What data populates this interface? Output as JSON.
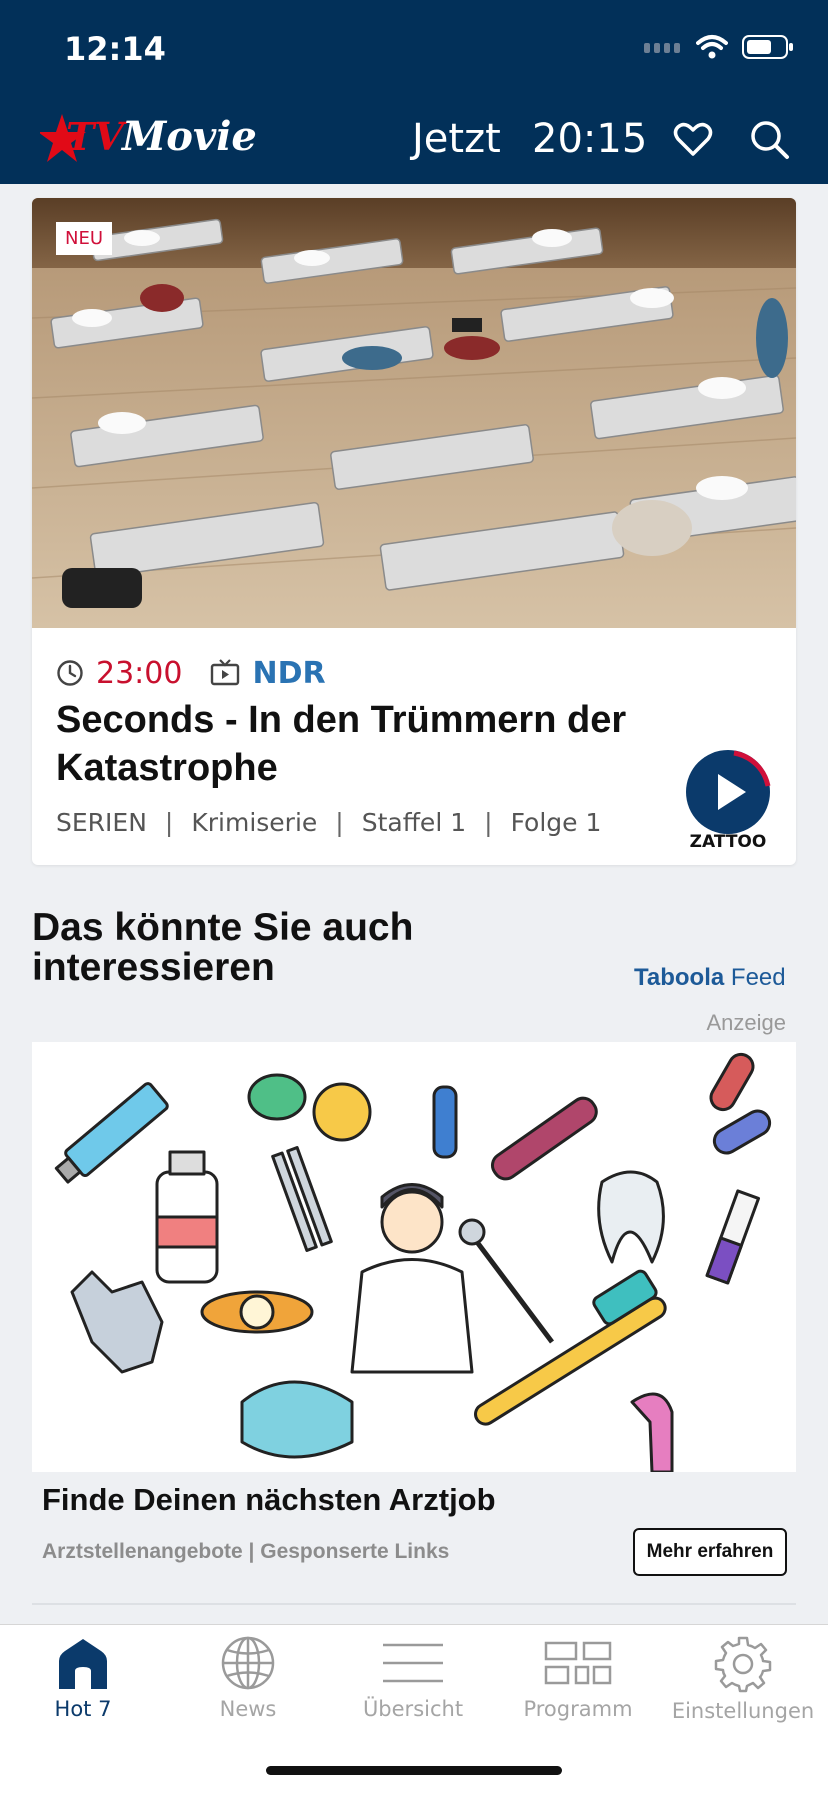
{
  "status_bar": {
    "time": "12:14"
  },
  "header": {
    "logo_text": "TV Movie",
    "nav_now": "Jetzt",
    "nav_primetime": "20:15",
    "icons": [
      "heart-icon",
      "search-icon"
    ]
  },
  "featured": {
    "badge": "NEU",
    "time": "23:00",
    "channel": "NDR",
    "title": "Seconds - In den Trümmern der Katastrophe",
    "tags": [
      "SERIEN",
      "Krimiserie",
      "Staffel 1",
      "Folge 1"
    ],
    "zattoo_label": "ZATTOO",
    "colors": {
      "time": "#c8102e",
      "channel": "#2a73b3",
      "zattoo": "#0b3a6b"
    }
  },
  "recommendations": {
    "title": "Das könnte Sie auch interessieren",
    "provider_brand": "Taboola",
    "provider_feed": "Feed",
    "ad_label": "Anzeige",
    "ad": {
      "title": "Finde Deinen nächsten Arztjob",
      "source": "Arztstellenangebote | Gesponserte Links",
      "cta": "Mehr erfahren"
    }
  },
  "tabbar": {
    "items": [
      {
        "label": "Hot 7",
        "icon": "home-icon",
        "active": true
      },
      {
        "label": "News",
        "icon": "globe-icon",
        "active": false
      },
      {
        "label": "Übersicht",
        "icon": "list-icon",
        "active": false
      },
      {
        "label": "Programm",
        "icon": "grid-icon",
        "active": false
      },
      {
        "label": "Einstellungen",
        "icon": "gear-icon",
        "active": false
      }
    ]
  },
  "theme": {
    "header_bg": "#023059",
    "accent": "#0b3a6b"
  }
}
